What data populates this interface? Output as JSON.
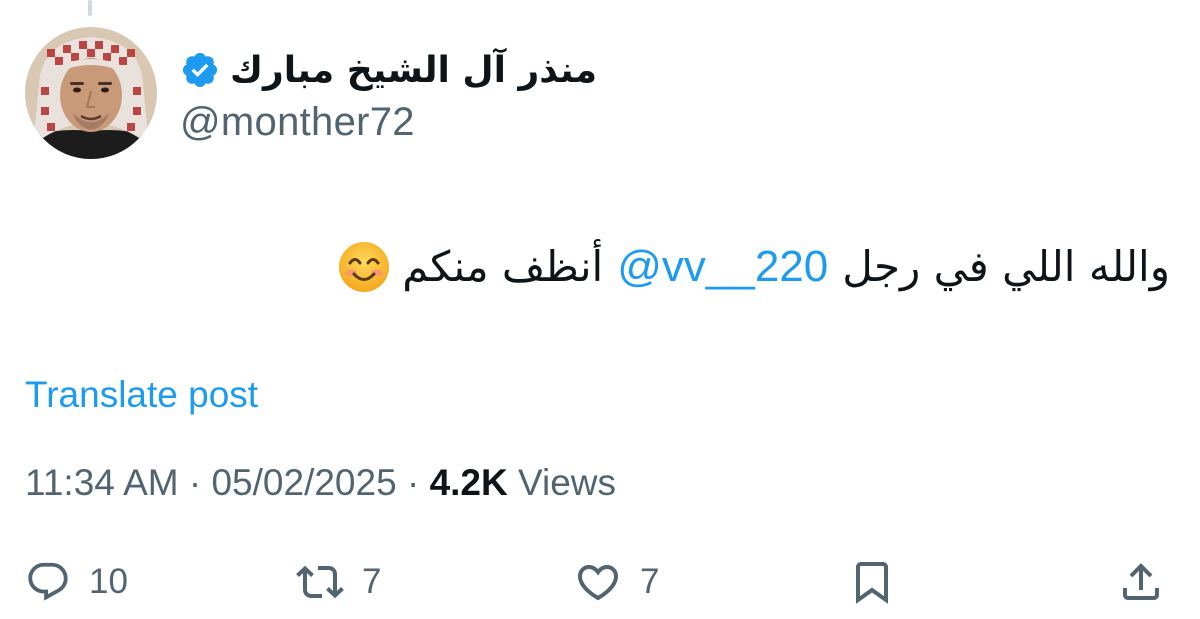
{
  "author": {
    "display_name": "منذر آل الشيخ مبارك",
    "handle": "@monther72",
    "verified": true
  },
  "tweet": {
    "text_before": "والله اللي في رجل",
    "mention": "@vv__220",
    "text_after": "أنظف منكم",
    "emoji": "smiling-face-with-smiling-eyes"
  },
  "translate_label": "Translate post",
  "meta": {
    "time": "11:34 AM",
    "separator": "·",
    "date": "05/02/2025",
    "views_count": "4.2K",
    "views_label": "Views"
  },
  "actions": {
    "replies": "10",
    "reposts": "7",
    "likes": "7"
  },
  "colors": {
    "accent": "#1d9bf0",
    "text": "#0f1419",
    "secondary": "#536471"
  }
}
